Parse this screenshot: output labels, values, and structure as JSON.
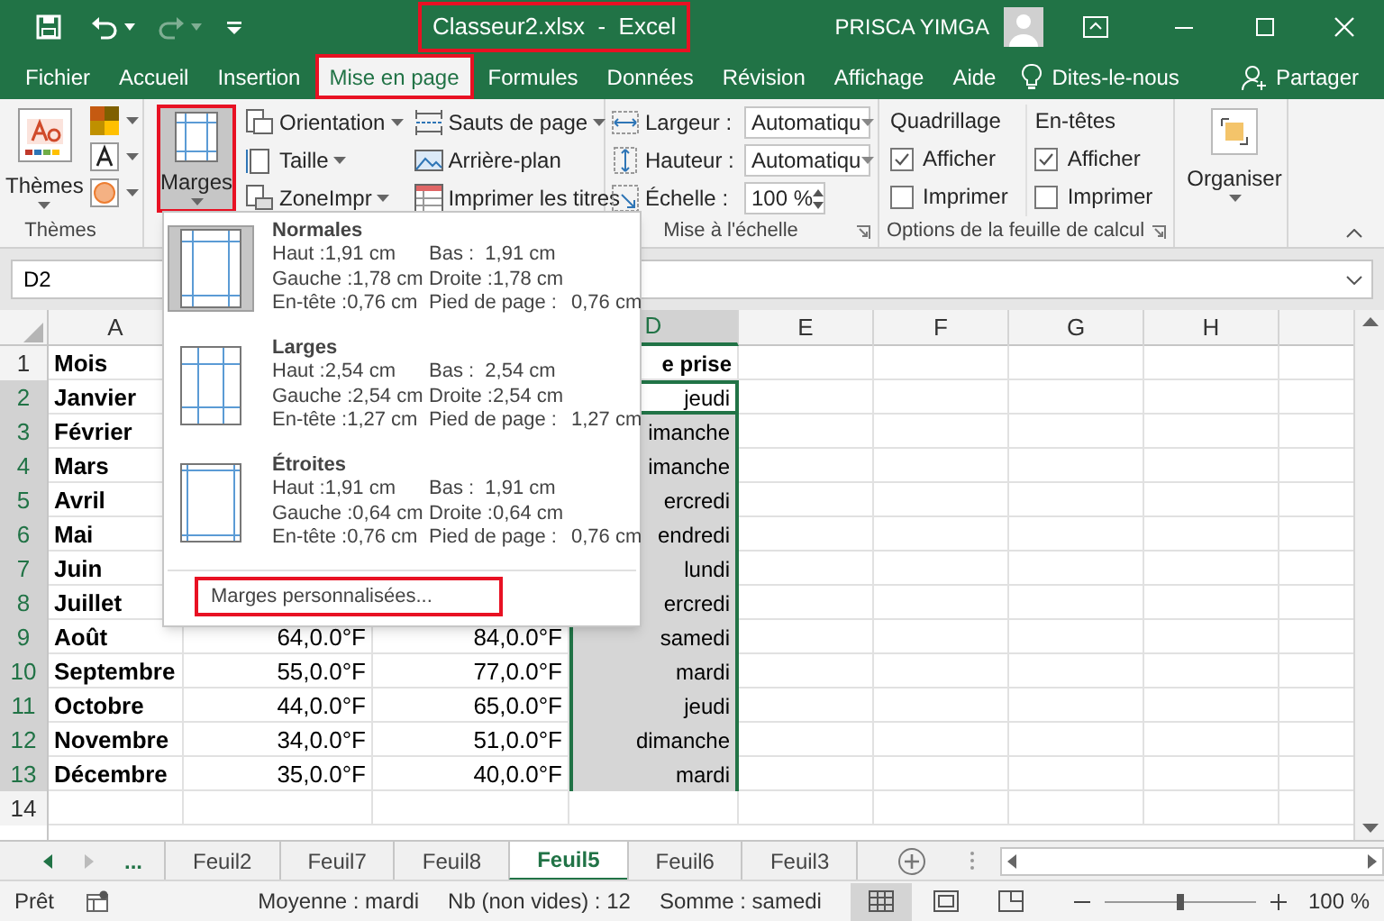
{
  "title_bar": {
    "title": "Classeur2.xlsx  -  Excel",
    "highlighted": true,
    "user": "PRISCA YIMGA"
  },
  "tabs": [
    {
      "label": "Fichier",
      "selected": false,
      "highlighted": false
    },
    {
      "label": "Accueil",
      "selected": false,
      "highlighted": false
    },
    {
      "label": "Insertion",
      "selected": false,
      "highlighted": false
    },
    {
      "label": "Mise en page",
      "selected": true,
      "highlighted": true
    },
    {
      "label": "Formules",
      "selected": false,
      "highlighted": false
    },
    {
      "label": "Données",
      "selected": false,
      "highlighted": false
    },
    {
      "label": "Révision",
      "selected": false,
      "highlighted": false
    },
    {
      "label": "Affichage",
      "selected": false,
      "highlighted": false
    },
    {
      "label": "Aide",
      "selected": false,
      "highlighted": false
    }
  ],
  "tell_me": "Dites-le-nous",
  "share": "Partager",
  "ribbon": {
    "themes": {
      "button": "Thèmes",
      "label": "Thèmes"
    },
    "margins": {
      "label": "Marges",
      "selected": true,
      "highlighted": true
    },
    "page_setup_columns": [
      [
        {
          "label": "Orientation",
          "dropdown": true
        },
        {
          "label": "Taille",
          "dropdown": true
        },
        {
          "label": "ZoneImpr",
          "dropdown": true
        }
      ],
      [
        {
          "label": "Sauts de page",
          "dropdown": true
        },
        {
          "label": "Arrière-plan",
          "dropdown": false
        },
        {
          "label": "Imprimer les titres",
          "dropdown": false
        }
      ]
    ],
    "scale": {
      "fields": [
        {
          "label": "Largeur :",
          "value": "Automatiqu",
          "kind": "dropdown"
        },
        {
          "label": "Hauteur :",
          "value": "Automatiqu",
          "kind": "dropdown"
        },
        {
          "label": "Échelle :",
          "value": "100 %",
          "kind": "spinner"
        }
      ],
      "label": "Mise à l'échelle"
    },
    "sheet_options": {
      "columns": [
        {
          "title": "Quadrillage",
          "options": [
            {
              "label": "Afficher",
              "checked": true
            },
            {
              "label": "Imprimer",
              "checked": false
            }
          ]
        },
        {
          "title": "En-têtes",
          "options": [
            {
              "label": "Afficher",
              "checked": true
            },
            {
              "label": "Imprimer",
              "checked": false
            }
          ]
        }
      ],
      "label": "Options de la feuille de calcul"
    },
    "arrange": {
      "label": "Organiser"
    }
  },
  "margins_menu": {
    "presets": [
      {
        "name": "Normales",
        "kind": "normal",
        "selected": true,
        "lines": [
          [
            "Haut :1,91 cm",
            "Bas :  1,91 cm"
          ],
          [
            "Gauche :1,78 cm",
            "Droite :1,78 cm"
          ],
          [
            "En-tête :0,76 cm",
            "Pied de page :",
            "0,76 cm"
          ]
        ]
      },
      {
        "name": "Larges",
        "kind": "wide",
        "selected": false,
        "lines": [
          [
            "Haut :2,54 cm",
            "Bas :  2,54 cm"
          ],
          [
            "Gauche :2,54 cm",
            "Droite :2,54 cm"
          ],
          [
            "En-tête :1,27 cm",
            "Pied de page :",
            "1,27 cm"
          ]
        ]
      },
      {
        "name": "Étroites",
        "kind": "narrow",
        "selected": false,
        "lines": [
          [
            "Haut :1,91 cm",
            "Bas :  1,91 cm"
          ],
          [
            "Gauche :0,64 cm",
            "Droite :0,64 cm"
          ],
          [
            "En-tête :0,76 cm",
            "Pied de page :",
            "0,76 cm"
          ]
        ]
      }
    ],
    "custom": {
      "label": "Marges personnalisées...",
      "highlighted": true
    }
  },
  "name_box": "D2",
  "sheet": {
    "columns": [
      {
        "label": "A",
        "selected": false
      },
      {
        "label": "D",
        "selected": true
      },
      {
        "label": "E",
        "selected": false
      },
      {
        "label": "F",
        "selected": false
      },
      {
        "label": "G",
        "selected": false
      },
      {
        "label": "H",
        "selected": false
      }
    ],
    "rows": [
      {
        "header": "1",
        "selected": false,
        "active": false,
        "cells": {
          "A": "Mois",
          "D": "e prise"
        }
      },
      {
        "header": "2",
        "selected": true,
        "active": true,
        "cells": {
          "A": "Janvier",
          "D": "jeudi"
        }
      },
      {
        "header": "3",
        "selected": true,
        "active": false,
        "cells": {
          "A": "Février",
          "D": "imanche"
        }
      },
      {
        "header": "4",
        "selected": true,
        "active": false,
        "cells": {
          "A": "Mars",
          "D": "imanche"
        }
      },
      {
        "header": "5",
        "selected": true,
        "active": false,
        "cells": {
          "A": "Avril",
          "D": "ercredi"
        }
      },
      {
        "header": "6",
        "selected": true,
        "active": false,
        "cells": {
          "A": "Mai",
          "D": "endredi"
        }
      },
      {
        "header": "7",
        "selected": true,
        "active": false,
        "cells": {
          "A": "Juin",
          "D": "lundi"
        }
      },
      {
        "header": "8",
        "selected": true,
        "active": false,
        "cells": {
          "A": "Juillet",
          "D": "ercredi"
        }
      },
      {
        "header": "9",
        "selected": true,
        "active": false,
        "cells": {
          "A": "Août",
          "B": "64,0.0°F",
          "C": "84,0.0°F",
          "D": "samedi"
        }
      },
      {
        "header": "10",
        "selected": true,
        "active": false,
        "cells": {
          "A": "Septembre",
          "B": "55,0.0°F",
          "C": "77,0.0°F",
          "D": "mardi"
        }
      },
      {
        "header": "11",
        "selected": true,
        "active": false,
        "cells": {
          "A": "Octobre",
          "B": "44,0.0°F",
          "C": "65,0.0°F",
          "D": "jeudi"
        }
      },
      {
        "header": "12",
        "selected": true,
        "active": false,
        "cells": {
          "A": "Novembre",
          "B": "34,0.0°F",
          "C": "51,0.0°F",
          "D": "dimanche"
        }
      },
      {
        "header": "13",
        "selected": true,
        "active": false,
        "cells": {
          "A": "Décembre",
          "B": "35,0.0°F",
          "C": "40,0.0°F",
          "D": "mardi"
        }
      },
      {
        "header": "14",
        "selected": false,
        "active": false
      }
    ]
  },
  "sheet_nav": {
    "more": "..."
  },
  "sheet_tabs": [
    {
      "label": "Feuil2",
      "selected": false
    },
    {
      "label": "Feuil7",
      "selected": false
    },
    {
      "label": "Feuil8",
      "selected": false
    },
    {
      "label": "Feuil5",
      "selected": true
    },
    {
      "label": "Feuil6",
      "selected": false
    },
    {
      "label": "Feuil3",
      "selected": false
    }
  ],
  "status_bar": {
    "ready": "Prêt",
    "stats": [
      "Moyenne : mardi",
      "Nb (non vides) : 12",
      "Somme : samedi"
    ],
    "views": [
      {
        "kind": "normal",
        "selected": true
      },
      {
        "kind": "page_layout",
        "selected": false
      },
      {
        "kind": "page_break",
        "selected": false
      }
    ],
    "zoom": {
      "level": 0.5,
      "label": "100 %"
    }
  }
}
